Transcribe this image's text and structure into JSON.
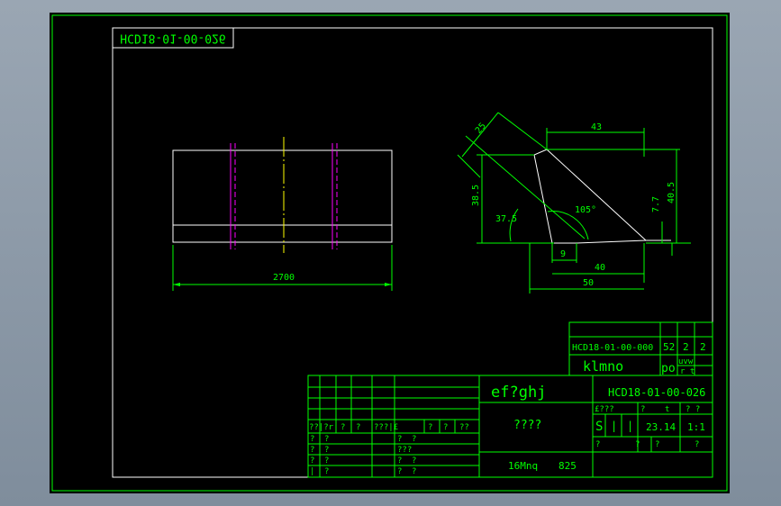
{
  "drawing_code_mirrored": "HCD18-01-00-026",
  "front_view": {
    "length_dim": "2700"
  },
  "side_view": {
    "dims": {
      "d25": "25",
      "d43": "43",
      "d38_5": "38.5",
      "d37_5": "37.5",
      "d105": "105°",
      "d7_7": "7.7",
      "d40_5": "40.5",
      "d9": "9",
      "d40": "40",
      "d50": "50"
    }
  },
  "title_block": {
    "parent_code": "HCD18-01-00-000",
    "parent_qty1": "52",
    "parent_qty2": "2",
    "parent_qty3": "2",
    "parent_name": "klmno",
    "parent_po": "po",
    "parent_uvw": "uvw",
    "parent_rt": "r t",
    "part_name": "ef?ghj",
    "part_code": "HCD18-01-00-026",
    "part_sub": "????",
    "material": "16Mnq",
    "mat_code": "825",
    "stage_hdr": "£???",
    "q_hdr": "?",
    "t_hdr": "t",
    "qq_hdr": "? ?",
    "stage_S": "S",
    "stage_bar1": "|",
    "stage_bar2": "|",
    "weight": "23.14",
    "scale": "1:1",
    "sheet_q1": "?",
    "sheet_q2": "?",
    "sheet_q3": "?",
    "sheet_q4": "?",
    "sig_header": [
      "??|?r",
      "?",
      "?",
      "???|£",
      "?",
      "?",
      "??"
    ],
    "sig_rows": [
      [
        "?",
        "?",
        "?",
        "?"
      ],
      [
        "?",
        "?",
        "???",
        ""
      ],
      [
        "?",
        "?",
        "?",
        "?"
      ],
      [
        "|",
        "?",
        "?",
        "?"
      ]
    ]
  }
}
